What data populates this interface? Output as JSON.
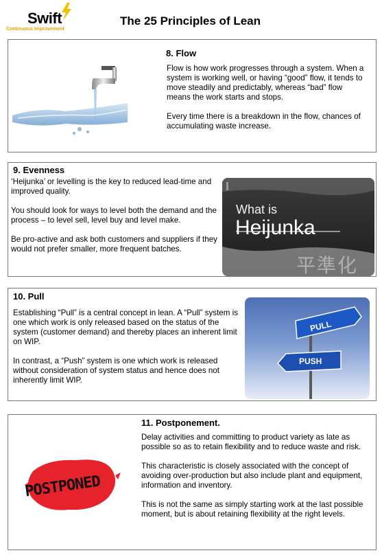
{
  "logo": {
    "brand": "Swift",
    "tagline": "Continuous Improvement"
  },
  "document_title": "The 25 Principles of Lean",
  "sections": [
    {
      "title": "8. Flow",
      "paragraphs": [
        "Flow is how work progresses through a system. When a system is working well, or having “good” flow, it tends to move steadily and predictably, whereas “bad” flow means the work starts and stops.",
        "Every time there is a breakdown in the flow, chances of accumulating waste increase."
      ]
    },
    {
      "title": "9. Evenness",
      "paragraphs": [
        "‘Heijunka’ or levelling is the key to reduced lead-time and improved quality.",
        "You should look for ways to level both the demand and the process – to level sell, level buy and level make.",
        "Be pro-active and ask both customers and suppliers if they would not prefer smaller, more frequent batches."
      ],
      "image": {
        "line1": "What is",
        "line2": "Heijunka",
        "kanji": "平準化"
      }
    },
    {
      "title": "10. Pull",
      "paragraphs": [
        "Establishing “Pull” is a central concept in lean. A “Pull” system is one which work is only released based on the status of the system (customer demand) and thereby places an inherent limit on WIP.",
        "In contrast, a “Push” system is one which work is released without consideration of system status and hence does not inherently limit WIP."
      ],
      "image": {
        "sign1": "PULL",
        "sign2": "PUSH"
      }
    },
    {
      "title": "11. Postponement.",
      "paragraphs": [
        "Delay activities and committing to product variety as late as possible so as to retain flexibility and to reduce waste and risk.",
        "This characteristic is closely associated with the concept of avoiding over-production but also include plant and equipment, information and inventory.",
        "This is not the same as simply starting work at the last possible moment, but is about retaining flexibility at the right levels."
      ],
      "image": {
        "stamp": "POSTPONED"
      }
    }
  ]
}
